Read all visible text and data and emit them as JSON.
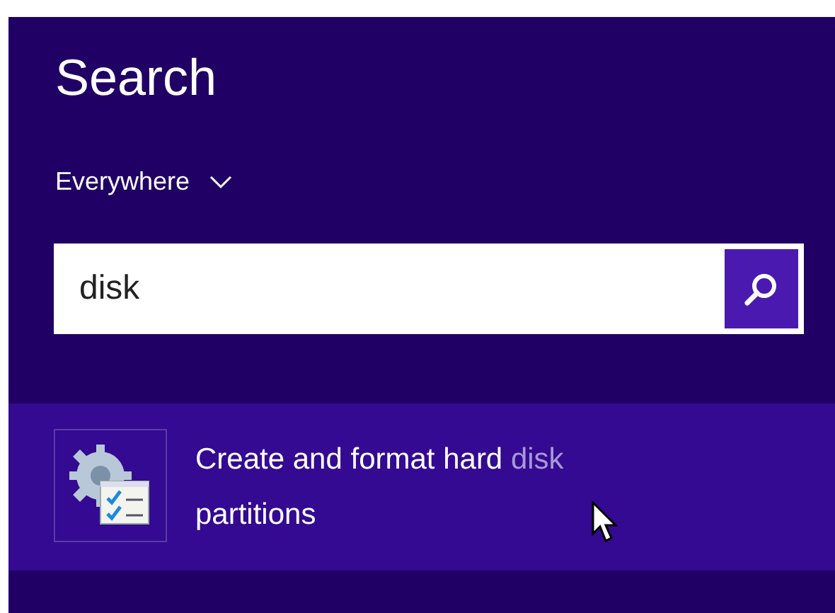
{
  "title": "Search",
  "scope": {
    "label": "Everywhere",
    "expanded": false
  },
  "search": {
    "value": "disk"
  },
  "results": [
    {
      "selected": true,
      "parts": [
        {
          "text": "Create and format hard ",
          "match": false
        },
        {
          "text": "disk",
          "match": true
        },
        {
          "text": " partitions",
          "match": false
        }
      ]
    }
  ]
}
